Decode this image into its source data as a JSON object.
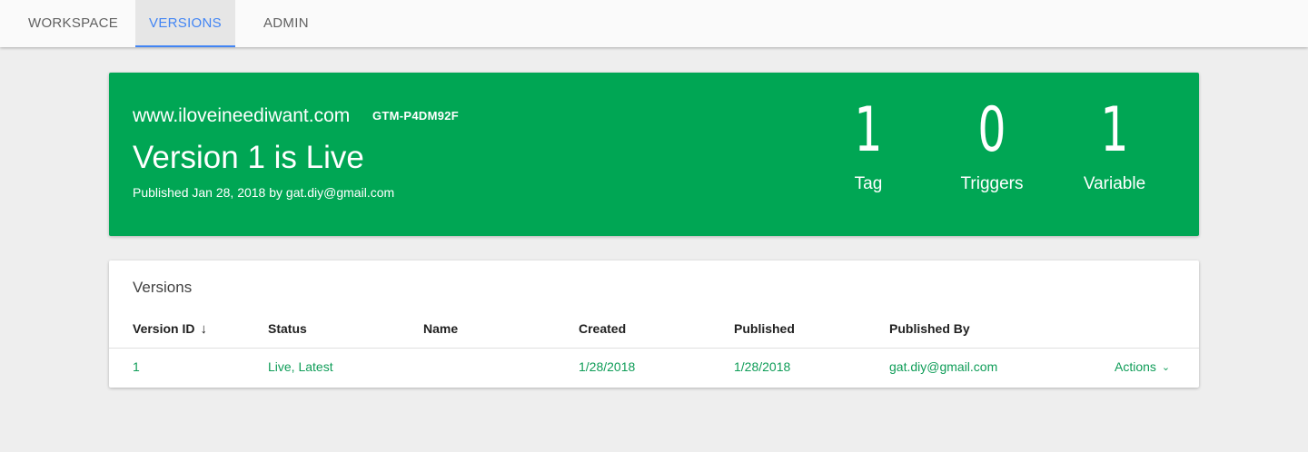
{
  "nav": {
    "tabs": [
      {
        "label": "WORKSPACE",
        "active": false
      },
      {
        "label": "VERSIONS",
        "active": true
      },
      {
        "label": "ADMIN",
        "active": false
      }
    ]
  },
  "hero": {
    "site": "www.iloveineediwant.com",
    "container_id": "GTM-P4DM92F",
    "title": "Version 1 is Live",
    "published_line": "Published Jan 28, 2018 by gat.diy@gmail.com",
    "stats": [
      {
        "value": "1",
        "label": "Tag"
      },
      {
        "value": "0",
        "label": "Triggers"
      },
      {
        "value": "1",
        "label": "Variable"
      }
    ],
    "color": "#00a654"
  },
  "versions": {
    "title": "Versions",
    "columns": [
      "Version ID",
      "Status",
      "Name",
      "Created",
      "Published",
      "Published By"
    ],
    "sort_icon": "arrow-down-icon",
    "rows": [
      {
        "version_id": "1",
        "status": "Live, Latest",
        "name": "",
        "created": "1/28/2018",
        "published": "1/28/2018",
        "published_by": "gat.diy@gmail.com",
        "actions_label": "Actions"
      }
    ],
    "link_color": "#0f9d58"
  }
}
